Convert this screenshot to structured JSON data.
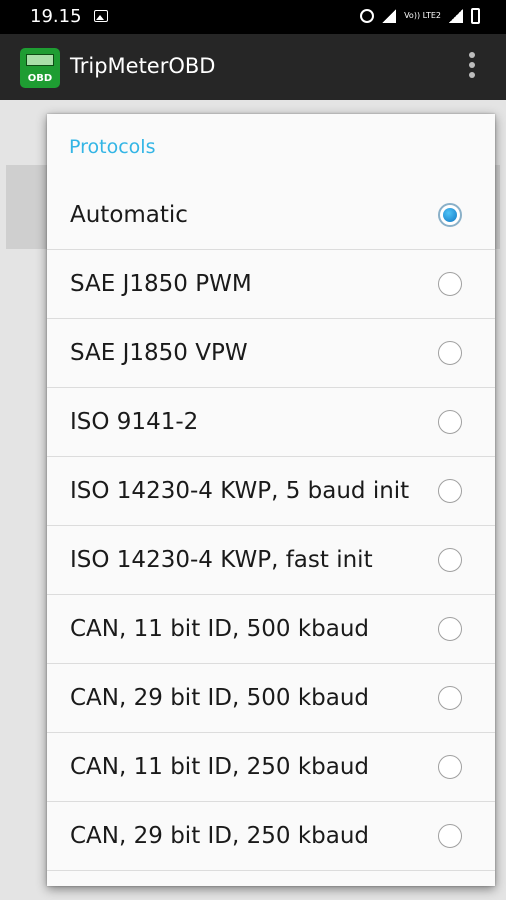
{
  "status_bar": {
    "time": "19.15",
    "lte_label": "Vo)) LTE2"
  },
  "app_bar": {
    "title": "TripMeterOBD",
    "logo_text": "OBD"
  },
  "dialog": {
    "title": "Protocols",
    "selected": "Automatic",
    "options": [
      {
        "label": "Automatic",
        "checked": true
      },
      {
        "label": "SAE J1850 PWM",
        "checked": false
      },
      {
        "label": "SAE J1850 VPW",
        "checked": false
      },
      {
        "label": "ISO 9141-2",
        "checked": false
      },
      {
        "label": "ISO 14230-4 KWP, 5 baud init",
        "checked": false
      },
      {
        "label": "ISO 14230-4 KWP, fast init",
        "checked": false
      },
      {
        "label": "CAN, 11 bit ID, 500 kbaud",
        "checked": false
      },
      {
        "label": "CAN, 29 bit ID, 500 kbaud",
        "checked": false
      },
      {
        "label": "CAN, 11 bit ID, 250 kbaud",
        "checked": false
      },
      {
        "label": "CAN, 29 bit ID, 250 kbaud",
        "checked": false
      }
    ]
  },
  "colors": {
    "accent": "#33b5e5",
    "app_bar": "#262626",
    "status_bar": "#000000",
    "logo": "#1e9d32"
  }
}
